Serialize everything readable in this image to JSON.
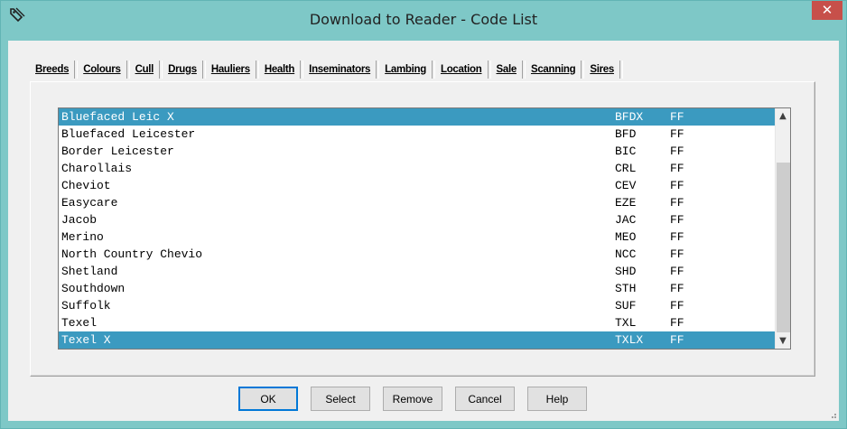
{
  "window": {
    "title": "Download to Reader - Code List",
    "close_glyph": "✕"
  },
  "tabs": [
    {
      "label": "Breeds",
      "active": true
    },
    {
      "label": "Colours",
      "active": false
    },
    {
      "label": "Cull",
      "active": false
    },
    {
      "label": "Drugs",
      "active": false
    },
    {
      "label": "Hauliers",
      "active": false
    },
    {
      "label": "Health",
      "active": false
    },
    {
      "label": "Inseminators",
      "active": false
    },
    {
      "label": "Lambing",
      "active": false
    },
    {
      "label": "Location",
      "active": false
    },
    {
      "label": "Sale",
      "active": false
    },
    {
      "label": "Scanning",
      "active": false
    },
    {
      "label": "Sires",
      "active": false
    }
  ],
  "list": {
    "rows": [
      {
        "name": "Bluefaced Leic X",
        "code": "BFDX",
        "flag": "FF",
        "selected": true
      },
      {
        "name": "Bluefaced Leicester",
        "code": "BFD",
        "flag": "FF",
        "selected": false
      },
      {
        "name": "Border Leicester",
        "code": "BIC",
        "flag": "FF",
        "selected": false
      },
      {
        "name": "Charollais",
        "code": "CRL",
        "flag": "FF",
        "selected": false
      },
      {
        "name": "Cheviot",
        "code": "CEV",
        "flag": "FF",
        "selected": false
      },
      {
        "name": "Easycare",
        "code": "EZE",
        "flag": "FF",
        "selected": false
      },
      {
        "name": "Jacob",
        "code": "JAC",
        "flag": "FF",
        "selected": false
      },
      {
        "name": "Merino",
        "code": "MEO",
        "flag": "FF",
        "selected": false
      },
      {
        "name": "North Country Chevio",
        "code": "NCC",
        "flag": "FF",
        "selected": false
      },
      {
        "name": "Shetland",
        "code": "SHD",
        "flag": "FF",
        "selected": false
      },
      {
        "name": "Southdown",
        "code": "STH",
        "flag": "FF",
        "selected": false
      },
      {
        "name": "Suffolk",
        "code": "SUF",
        "flag": "FF",
        "selected": false
      },
      {
        "name": "Texel",
        "code": "TXL",
        "flag": "FF",
        "selected": false
      },
      {
        "name": "Texel X",
        "code": "TXLX",
        "flag": "FF",
        "selected": true
      }
    ],
    "scroll_up_glyph": "▲",
    "scroll_down_glyph": "▼"
  },
  "buttons": {
    "ok": "OK",
    "select": "Select",
    "remove": "Remove",
    "cancel": "Cancel",
    "help": "Help"
  },
  "colors": {
    "titlebar": "#7ec8c7",
    "selection": "#3b9ac0",
    "close": "#c7504a"
  },
  "icons": {
    "app": "tag-icon",
    "close": "close-icon",
    "grip": "resize-grip-icon"
  }
}
